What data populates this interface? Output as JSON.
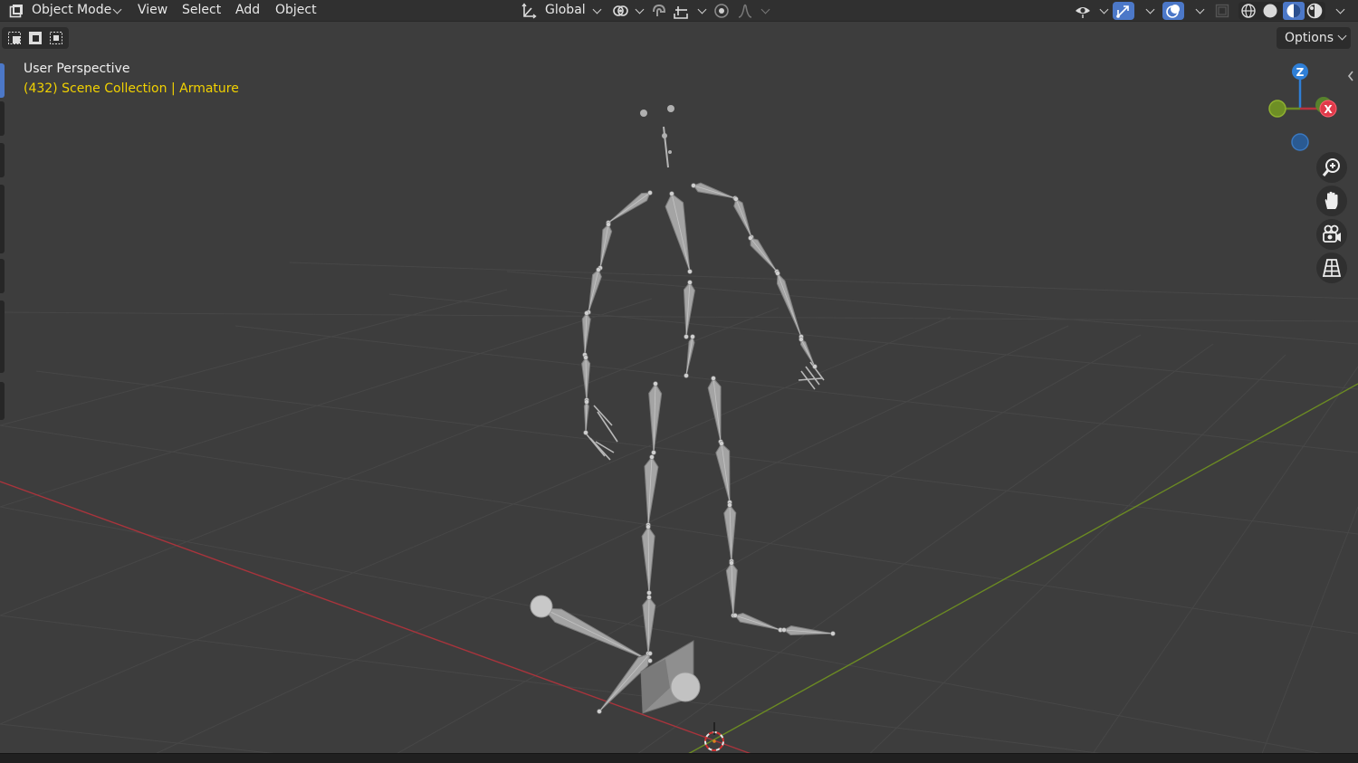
{
  "header": {
    "mode_label": "Object Mode",
    "menu": [
      "View",
      "Select",
      "Add",
      "Object"
    ],
    "transform_orientation": "Global"
  },
  "toolbar": {
    "options_label": "Options"
  },
  "overlay": {
    "view_name": "User Perspective",
    "frame": "(432)",
    "collection": "Scene Collection",
    "separator": "|",
    "active_object": "Armature"
  },
  "gizmo": {
    "z_label": "Z",
    "x_label": "X"
  },
  "icons": {
    "mode": "object-mode-icon",
    "orientation": "transform-orientation-icon",
    "pivot": "pivot-point-icon",
    "snap": "snap-magnet-icon",
    "snap_target": "snap-target-icon",
    "proportional": "proportional-edit-icon",
    "falloff": "falloff-curve-icon",
    "visibility": "eye-visibility-icon",
    "gizmos": "gizmo-toggle-icon",
    "overlays": "overlays-icon",
    "xray": "xray-icon",
    "shading_wireframe": "wireframe-shading-icon",
    "shading_solid": "solid-shading-icon",
    "shading_material": "material-shading-icon",
    "shading_rendered": "rendered-shading-icon",
    "zoom": "zoom-icon",
    "pan": "hand-pan-icon",
    "camera": "camera-view-icon",
    "ortho": "ortho-grid-icon"
  },
  "colors": {
    "viewport_bg": "#3d3d3d",
    "header_bg": "#303030",
    "x_axis": "#a8343c",
    "y_axis": "#6b8a23",
    "z_axis": "#2f7fd6",
    "collection_text": "#f2d200",
    "bone": "#a6a6a6"
  }
}
